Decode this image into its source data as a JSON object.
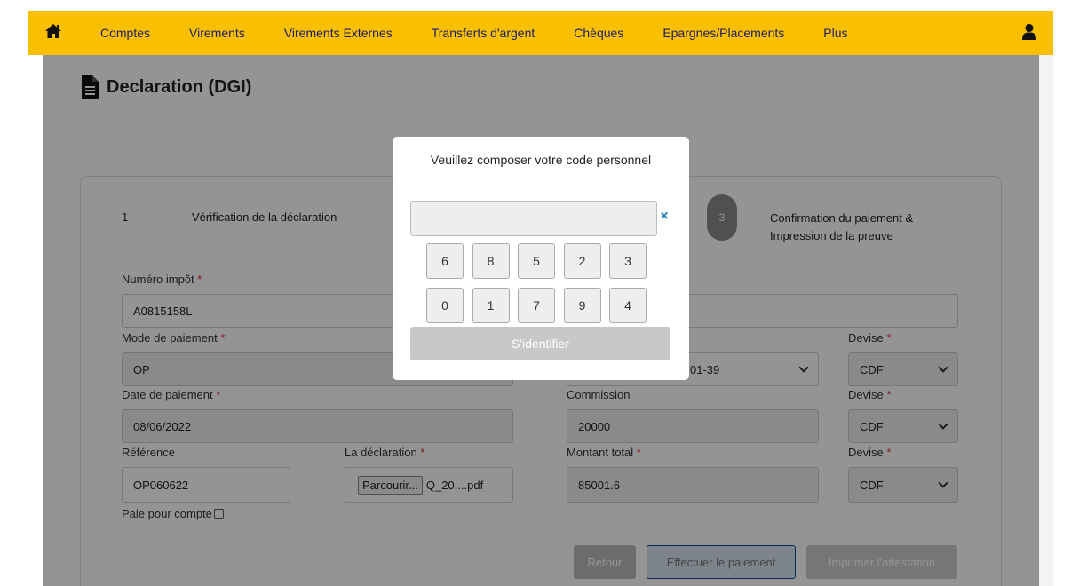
{
  "nav": {
    "items": [
      "Comptes",
      "Virements",
      "Virements Externes",
      "Transferts d'argent",
      "Chèques",
      "Epargnes/Placements",
      "Plus"
    ]
  },
  "page": {
    "title": "Declaration (DGI)"
  },
  "steps": {
    "step1_number": "1",
    "step1_label": "Vérification de la déclaration",
    "step3_number": "3",
    "step3_label": "Confirmation du paiement & Impression de la preuve"
  },
  "form": {
    "numero_impot_label": "Numéro impôt",
    "numero_impot_value": "A0815158L",
    "mode_paiement_label": "Mode de paiement",
    "mode_paiement_value": "OP",
    "compte_value_partial": "01-39",
    "devise_label": "Devise",
    "devise_value": "CDF",
    "date_paiement_label": "Date de paiement",
    "date_paiement_value": "08/06/2022",
    "commission_label": "Commission",
    "commission_value": "20000",
    "reference_label": "Référence",
    "reference_value": "OP060622",
    "declaration_label": "La déclaration",
    "browse_label": "Parcourir...",
    "file_name": "Q_20....pdf",
    "montant_total_label": "Montant total",
    "montant_total_value": "85001.6",
    "paie_pour_compte_label": "Paie pour compte",
    "required_mark": "*"
  },
  "actions": {
    "retour": "Retour",
    "effectuer": "Effectuer le paiement",
    "imprimer": "Imprimer l'attestation"
  },
  "modal": {
    "title": "Veuillez composer votre code personnel",
    "clear_symbol": "×",
    "keys_row1": [
      "6",
      "8",
      "5",
      "2",
      "3"
    ],
    "keys_row2": [
      "0",
      "1",
      "7",
      "9",
      "4"
    ],
    "login_label": "S'identifier"
  },
  "colors": {
    "nav_bg": "#f8c000",
    "nav_text": "#1b1b6b",
    "accent_blue": "#0d4ea0",
    "clear_icon": "#1e7fb8"
  }
}
